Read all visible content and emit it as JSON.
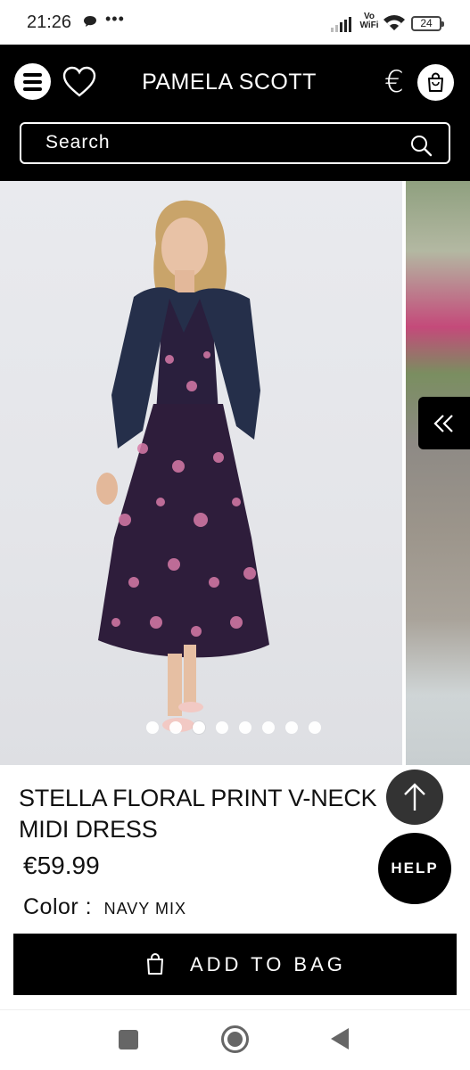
{
  "status_bar": {
    "time": "21:26",
    "more": "•••",
    "network": "Vo WiFi",
    "battery": "24"
  },
  "header": {
    "brand": "PAMELA SCOTT",
    "currency_symbol": "€",
    "search_placeholder": "Search"
  },
  "gallery": {
    "image_count": 8,
    "active_index": 2,
    "main_image": "woman-in-navy-floral-midi-dress-with-navy-cardigan",
    "next_image": "outdoor-garden-setting"
  },
  "product": {
    "title": "STELLA FLORAL PRINT V-NECK MIDI DRESS",
    "price": "€59.99",
    "color_label": "Color :",
    "color_value": "NAVY MIX"
  },
  "buttons": {
    "help": "HELP",
    "add_to_bag": "ADD TO BAG"
  },
  "colors": {
    "header_bg": "#000000",
    "accent": "#000000",
    "scroll_top_bg": "#333333"
  }
}
